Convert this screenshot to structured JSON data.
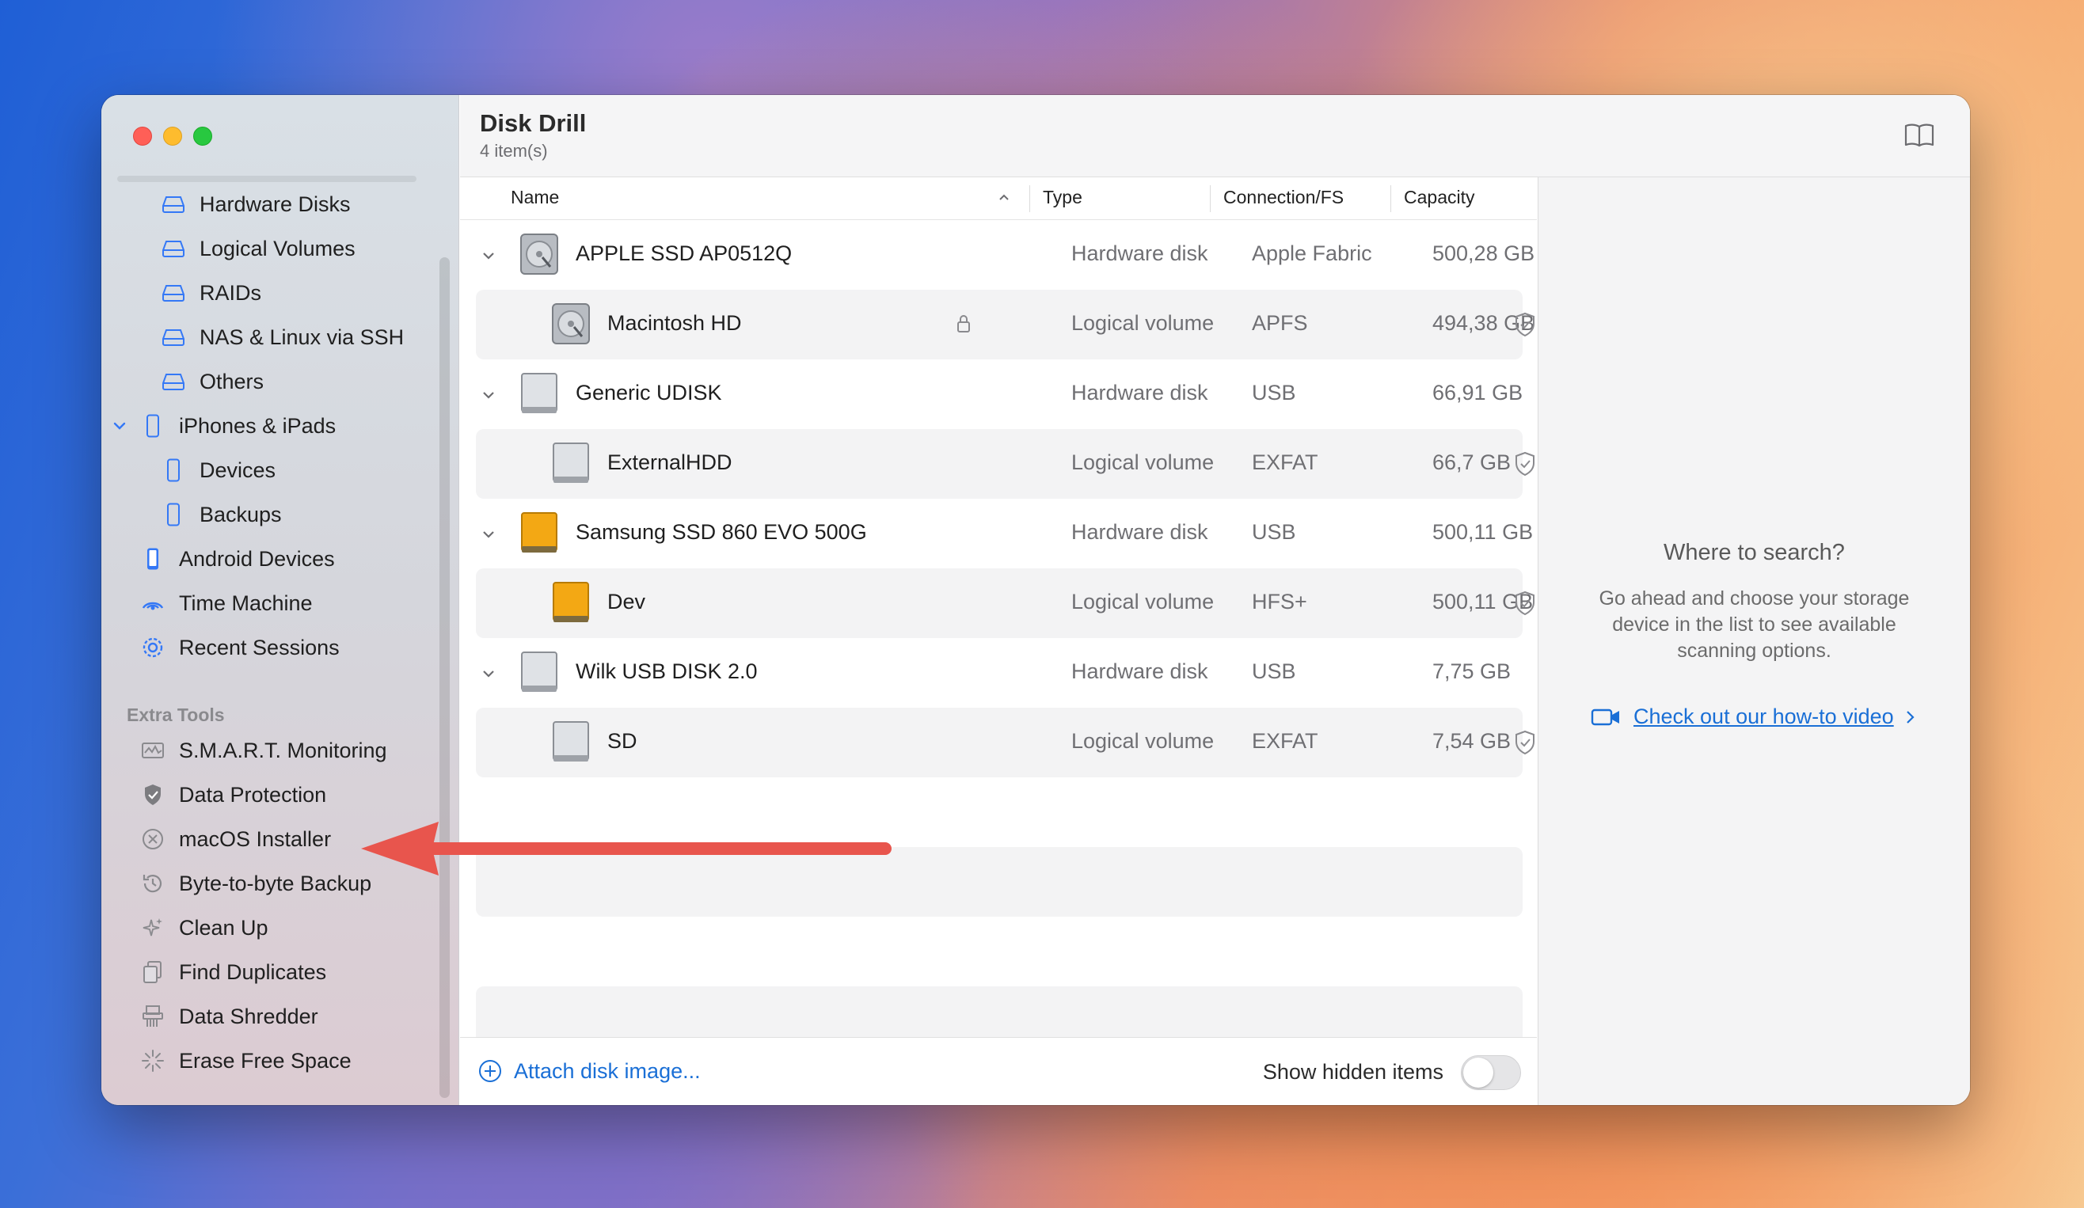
{
  "app": {
    "title": "Disk Drill",
    "subtitle": "4 item(s)"
  },
  "sidebar": {
    "items": [
      {
        "label": "Hardware Disks",
        "icon": "disk-icon"
      },
      {
        "label": "Logical Volumes",
        "icon": "disk-icon"
      },
      {
        "label": "RAIDs",
        "icon": "disk-icon"
      },
      {
        "label": "NAS & Linux via SSH",
        "icon": "disk-icon"
      },
      {
        "label": "Others",
        "icon": "disk-icon"
      },
      {
        "label": "iPhones & iPads",
        "icon": "phone-icon"
      },
      {
        "label": "Devices",
        "icon": "phone-icon"
      },
      {
        "label": "Backups",
        "icon": "phone-icon"
      },
      {
        "label": "Android Devices",
        "icon": "android-phone-icon"
      },
      {
        "label": "Time Machine",
        "icon": "time-machine-icon"
      },
      {
        "label": "Recent Sessions",
        "icon": "gear-icon"
      }
    ],
    "extra_title": "Extra Tools",
    "extra": [
      {
        "label": "S.M.A.R.T. Monitoring",
        "icon": "monitoring-icon"
      },
      {
        "label": "Data Protection",
        "icon": "shield-icon"
      },
      {
        "label": "macOS Installer",
        "icon": "installer-icon"
      },
      {
        "label": "Byte-to-byte Backup",
        "icon": "backup-clock-icon"
      },
      {
        "label": "Clean Up",
        "icon": "sparkle-icon"
      },
      {
        "label": "Find Duplicates",
        "icon": "duplicates-icon"
      },
      {
        "label": "Data Shredder",
        "icon": "shredder-icon"
      },
      {
        "label": "Erase Free Space",
        "icon": "erase-icon"
      }
    ]
  },
  "table": {
    "headers": {
      "name": "Name",
      "type": "Type",
      "conn": "Connection/FS",
      "capacity": "Capacity"
    },
    "rows": [
      {
        "name": "APPLE SSD AP0512Q",
        "type": "Hardware disk",
        "conn": "Apple Fabric",
        "capacity": "500,28 GB"
      },
      {
        "name": "Macintosh HD",
        "type": "Logical volume",
        "conn": "APFS",
        "capacity": "494,38 GB"
      },
      {
        "name": "Generic UDISK",
        "type": "Hardware disk",
        "conn": "USB",
        "capacity": "66,91 GB"
      },
      {
        "name": "ExternalHDD",
        "type": "Logical volume",
        "conn": "EXFAT",
        "capacity": "66,7 GB"
      },
      {
        "name": "Samsung SSD 860 EVO 500G",
        "type": "Hardware disk",
        "conn": "USB",
        "capacity": "500,11 GB"
      },
      {
        "name": "Dev",
        "type": "Logical volume",
        "conn": "HFS+",
        "capacity": "500,11 GB"
      },
      {
        "name": "Wilk USB DISK 2.0",
        "type": "Hardware disk",
        "conn": "USB",
        "capacity": "7,75 GB"
      },
      {
        "name": "SD",
        "type": "Logical volume",
        "conn": "EXFAT",
        "capacity": "7,54 GB"
      }
    ]
  },
  "footer": {
    "attach_label": "Attach disk image...",
    "hidden_label": "Show hidden items",
    "show_hidden": false
  },
  "right_pane": {
    "title": "Where to search?",
    "text": "Go ahead and choose your storage device in the list to see available scanning options.",
    "link": "Check out our how-to video"
  },
  "colors": {
    "accent": "#1a6fd6",
    "arrow": "#e8554d",
    "close": "#ff5f57",
    "minimize": "#febc2e",
    "maximize": "#28c840"
  }
}
